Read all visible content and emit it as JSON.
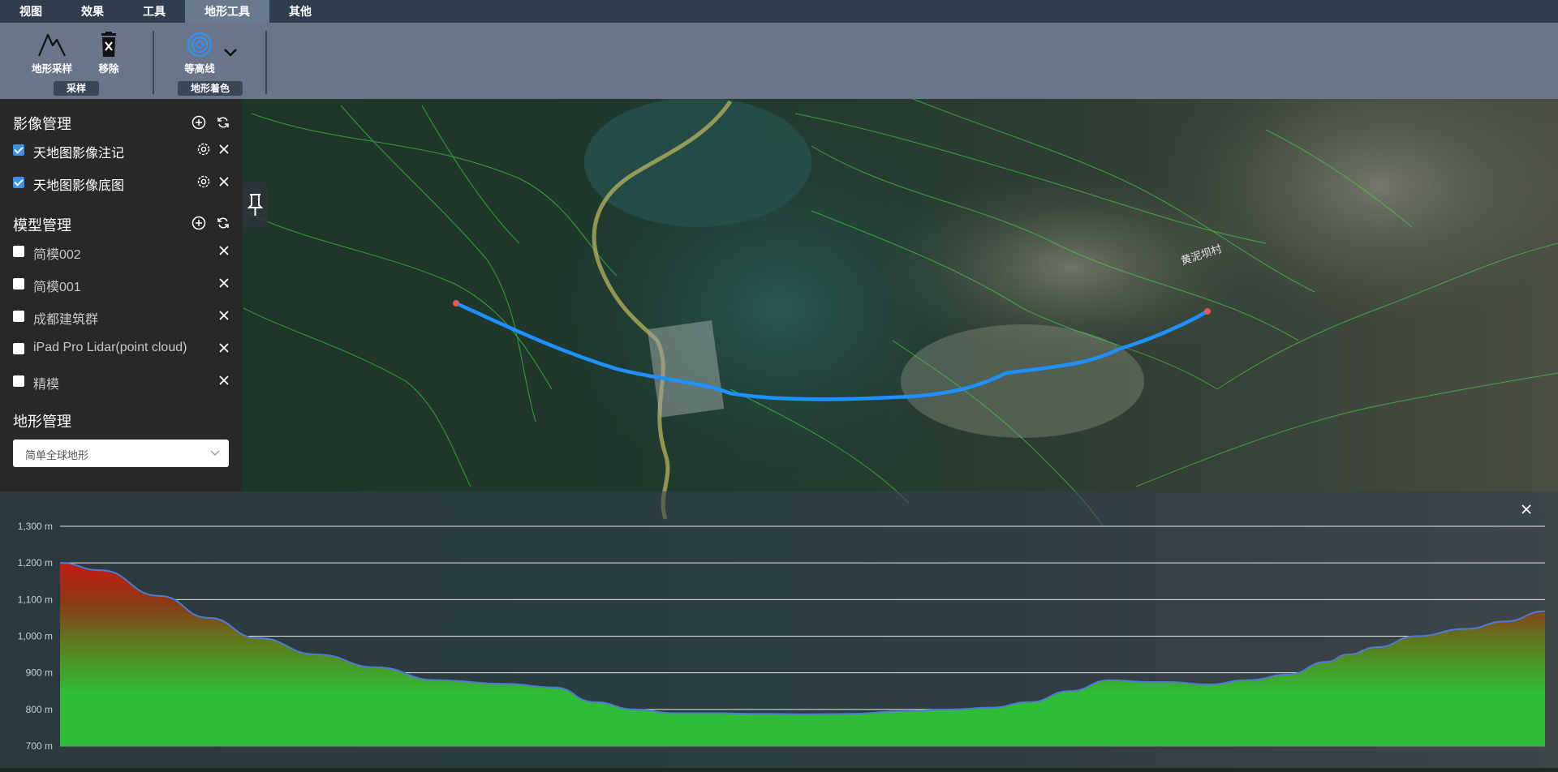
{
  "menu": {
    "tabs": [
      {
        "label": "视图"
      },
      {
        "label": "效果"
      },
      {
        "label": "工具"
      },
      {
        "label": "地形工具",
        "active": true
      },
      {
        "label": "其他"
      }
    ]
  },
  "ribbon": {
    "terrain_sample_label": "地形采样",
    "remove_label": "移除",
    "contour_label": "等高线",
    "group_sample": "采样",
    "group_coloring": "地形着色"
  },
  "sidebar": {
    "imagery": {
      "title": "影像管理",
      "items": [
        {
          "label": "天地图影像注记",
          "checked": true
        },
        {
          "label": "天地图影像底图",
          "checked": true
        }
      ]
    },
    "models": {
      "title": "模型管理",
      "items": [
        {
          "label": "简模002",
          "checked": false
        },
        {
          "label": "简模001",
          "checked": false
        },
        {
          "label": "成都建筑群",
          "checked": false
        },
        {
          "label": "iPad Pro Lidar(point cloud)",
          "checked": false
        },
        {
          "label": "精模",
          "checked": false
        }
      ]
    },
    "terrain": {
      "title": "地形管理",
      "selected": "简单全球地形"
    }
  },
  "colors": {
    "accent_blue": "#3d8fe8",
    "profile_line": "#4f79d6",
    "profile_top": "#c41a12",
    "profile_bottom": "#2fbd38",
    "contour": "#3ee83e",
    "route": "#1e90ff"
  },
  "icons": {
    "terrain_sample": "mountain-icon",
    "remove": "trash-icon",
    "contour": "contour-rings-icon",
    "dropdown": "chevron-down-icon",
    "add": "plus-circle-icon",
    "refresh": "refresh-icon",
    "settings": "gear-icon",
    "close": "close-icon",
    "pin": "pin-icon"
  },
  "chart_data": {
    "type": "area",
    "title": "",
    "xlabel": "",
    "ylabel": "",
    "y_unit": "m",
    "ylim": [
      700,
      1300
    ],
    "yticks": [
      "1,300 m",
      "1,200 m",
      "1,100 m",
      "1,000 m",
      "900 m",
      "800 m",
      "700 m"
    ],
    "ytick_values": [
      1300,
      1200,
      1100,
      1000,
      900,
      800,
      700
    ],
    "grid": true,
    "legend": "none",
    "x": [
      0,
      0.027,
      0.067,
      0.1,
      0.133,
      0.173,
      0.213,
      0.253,
      0.3,
      0.333,
      0.36,
      0.387,
      0.413,
      0.44,
      0.467,
      0.48,
      0.5,
      0.533,
      0.567,
      0.6,
      0.627,
      0.653,
      0.68,
      0.707,
      0.733,
      0.747,
      0.773,
      0.8,
      0.827,
      0.853,
      0.867,
      0.887,
      0.913,
      0.947,
      0.973,
      1.0
    ],
    "values": [
      1200,
      1180,
      1110,
      1050,
      995,
      950,
      915,
      880,
      870,
      860,
      820,
      800,
      790,
      790,
      788,
      788,
      787,
      788,
      795,
      800,
      805,
      820,
      850,
      880,
      875,
      875,
      868,
      880,
      895,
      930,
      950,
      970,
      1000,
      1020,
      1040,
      1068
    ]
  }
}
